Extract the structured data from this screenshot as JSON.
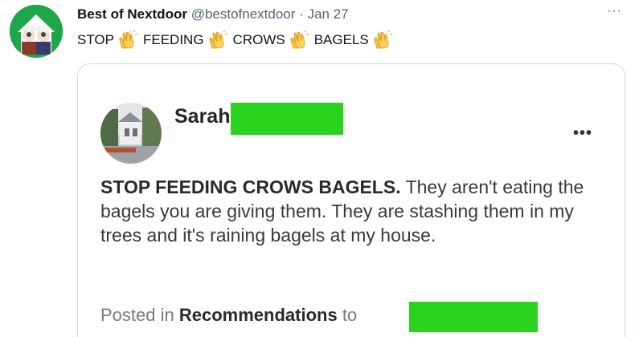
{
  "author": {
    "display_name": "Best of Nextdoor",
    "handle": "@bestofnextdoor",
    "separator": "·",
    "date": "Jan 27"
  },
  "menu": {
    "more_label": "···"
  },
  "tweet": {
    "words": [
      "STOP",
      "FEEDING",
      "CROWS",
      "BAGELS"
    ],
    "emoji_icon": "clapping-hands-icon"
  },
  "embedded_post": {
    "author_name": "Sarah",
    "more_label": "•••",
    "body_bold": "STOP FEEDING CROWS BAGELS.",
    "body_rest": "They aren't eating the bagels you are giving them. They are stashing them in my trees and it's raining bagels at my house.",
    "footer": {
      "prefix": "Posted in",
      "category": "Recommendations",
      "to_label": "to"
    },
    "redaction_color": "#2bd31f"
  },
  "colors": {
    "avatar_bg": "#1fa64a",
    "text_primary": "#0f1419",
    "text_secondary": "#536471",
    "card_border": "#cfd9de"
  }
}
